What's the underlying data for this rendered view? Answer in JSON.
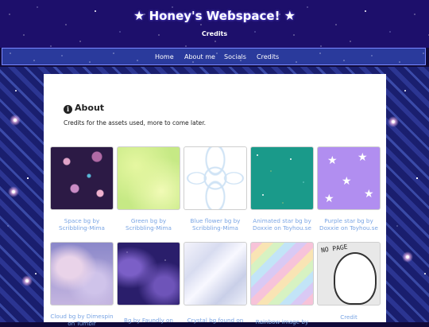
{
  "site": {
    "title": "Honey's Webspace!",
    "title_star": "★",
    "subtitle": "Credits"
  },
  "nav": {
    "items": [
      "Home",
      "About me",
      "Socials",
      "Credits"
    ]
  },
  "about": {
    "heading": "About",
    "icon": "info-icon",
    "intro": "Credits for the assets used, more to come later."
  },
  "credits": [
    {
      "caption": "Space bg by Scribbling-Mima"
    },
    {
      "caption": "Green bg by Scribbling-Mima"
    },
    {
      "caption": "Blue flower bg by Scribbling-Mima"
    },
    {
      "caption": "Animated star bg by Doxxie on Toyhou.se"
    },
    {
      "caption": "Purple star bg by Doxxie on Toyhou.se"
    },
    {
      "caption": "Cloud bg by Dimespin on Tumblr"
    },
    {
      "caption": "Bg by Faundly on"
    },
    {
      "caption": "Crystal bg found on"
    },
    {
      "caption": "Rainbow image by"
    },
    {
      "caption": "Credit"
    }
  ],
  "credit_thumb_text": "NO PAGE",
  "colors": {
    "link": "#7aa5e4",
    "header_bg": "#1d0f6b",
    "nav_bg": "#2a3a9c",
    "content_bg": "#ffffff"
  }
}
